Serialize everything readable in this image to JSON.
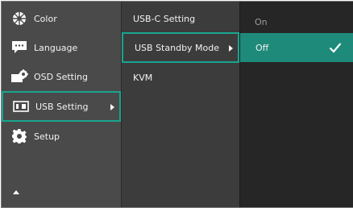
{
  "main_menu": {
    "items": [
      {
        "label": "Color",
        "icon": "color-wheel-icon"
      },
      {
        "label": "Language",
        "icon": "speech-bubble-icon"
      },
      {
        "label": "OSD Setting",
        "icon": "osd-settings-icon"
      },
      {
        "label": "USB Setting",
        "icon": "usb-port-icon"
      },
      {
        "label": "Setup",
        "icon": "gear-icon"
      }
    ],
    "selected_index": 3
  },
  "sub_menu": {
    "items": [
      {
        "label": "USB-C Setting"
      },
      {
        "label": "USB Standby Mode"
      },
      {
        "label": "KVM"
      }
    ],
    "selected_index": 1
  },
  "options": {
    "items": [
      {
        "label": "On"
      },
      {
        "label": "Off"
      }
    ],
    "selected_index": 1
  },
  "colors": {
    "accent": "#19a58f",
    "highlight_fill": "#1e8a79",
    "main_bg": "#4a4a4a",
    "sub_bg": "#3c3c3c",
    "option_bg": "#262626"
  }
}
